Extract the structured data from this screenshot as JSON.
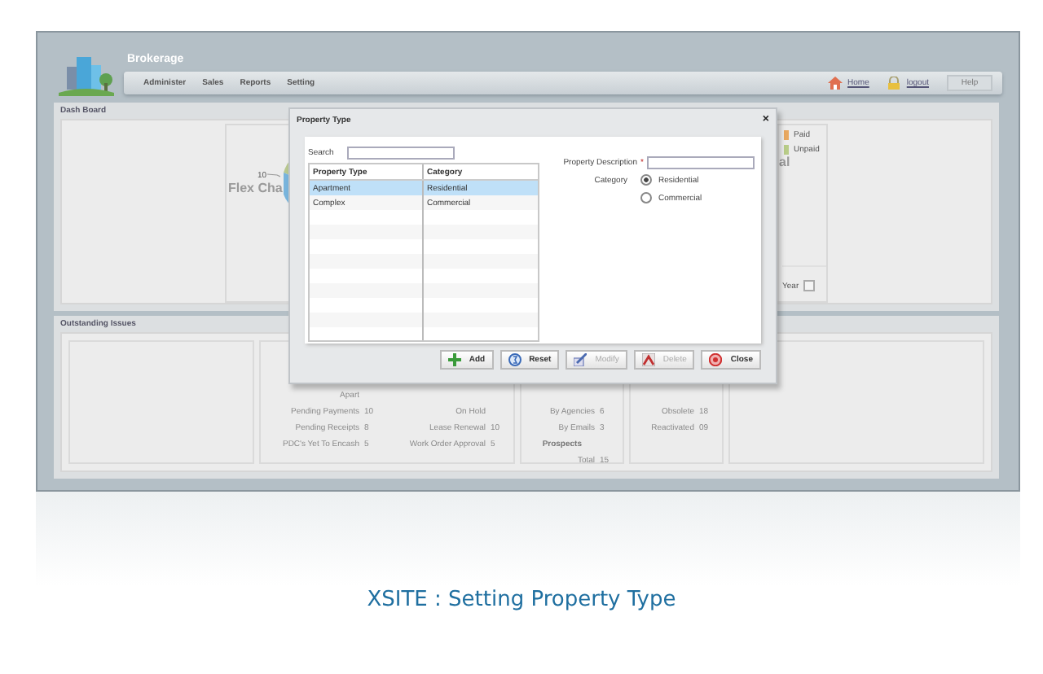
{
  "app": {
    "title": "Brokerage"
  },
  "nav": {
    "items": [
      "Administer",
      "Sales",
      "Reports",
      "Setting"
    ],
    "links": [
      {
        "label": "Home",
        "kind": "home"
      },
      {
        "label": "logout",
        "kind": "logout"
      }
    ],
    "help": "Help"
  },
  "dashboard": {
    "title": "Dash Board",
    "pie_label": "10",
    "watermark_left": "Flex Cha",
    "watermark_right": "al",
    "legend": [
      {
        "label": "Paid",
        "color": "#e8a860"
      },
      {
        "label": "Unpaid",
        "color": "#b8cc88"
      }
    ],
    "year": {
      "label": "Year",
      "checked": false
    }
  },
  "outstanding": {
    "title": "Outstanding Issues",
    "groups": [
      {
        "rows": [
          {
            "cells": [
              {
                "label": "Apart"
              }
            ]
          },
          {
            "cells": [
              {
                "label": "Pending Payments",
                "value": "10"
              },
              {
                "label": "On Hold"
              }
            ]
          },
          {
            "cells": [
              {
                "label": "Pending Receipts",
                "value": "8"
              },
              {
                "label": "Lease Renewal",
                "value": "10"
              }
            ]
          },
          {
            "cells": [
              {
                "label": "PDC's Yet To Encash",
                "value": "5"
              },
              {
                "label": "Work Order Approval",
                "value": "5"
              }
            ]
          }
        ]
      },
      {
        "rows": [
          {
            "cells": [
              {
                "label": "By Agencies",
                "value": "6"
              }
            ]
          },
          {
            "cells": [
              {
                "label": "By Emails",
                "value": "3"
              }
            ]
          },
          {
            "cells": [
              {
                "label": "Prospects",
                "kind": "heading"
              }
            ]
          },
          {
            "cells": [
              {
                "label": "Total",
                "value": "15"
              }
            ]
          }
        ]
      },
      {
        "rows": [
          {
            "cells": [
              {
                "label": "Obsolete",
                "value": "18"
              }
            ]
          },
          {
            "cells": [
              {
                "label": "Reactivated",
                "value": "09"
              }
            ]
          }
        ]
      }
    ]
  },
  "dialog": {
    "title": "Property Type",
    "close": "×",
    "search": {
      "label": "Search"
    },
    "table": {
      "columns": [
        "Property Type",
        "Category"
      ],
      "rows": [
        {
          "cells": [
            "Apartment",
            "Residential"
          ],
          "selected": true
        },
        {
          "cells": [
            "Complex",
            "Commercial"
          ],
          "selected": false
        }
      ]
    },
    "form": {
      "description_label": "Property Description",
      "required_mark": "*",
      "category_label": "Category",
      "options": [
        {
          "label": "Residential",
          "selected": true
        },
        {
          "label": "Commercial",
          "selected": false
        }
      ]
    },
    "buttons": [
      {
        "label": "Add",
        "kind": "add",
        "disabled": false
      },
      {
        "label": "Reset",
        "kind": "reset",
        "disabled": false
      },
      {
        "label": "Modify",
        "kind": "modify",
        "disabled": true
      },
      {
        "label": "Delete",
        "kind": "delete",
        "disabled": true
      },
      {
        "label": "Close",
        "kind": "close",
        "disabled": false
      }
    ]
  },
  "caption": "XSITE : Setting Property Type"
}
